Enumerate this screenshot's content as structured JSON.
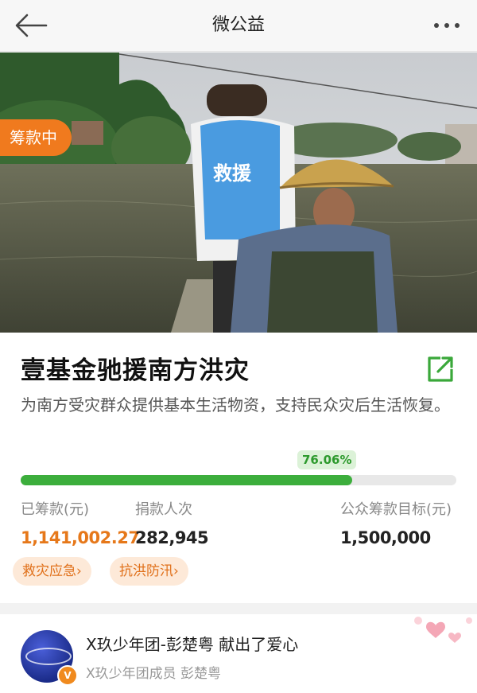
{
  "nav": {
    "title": "微公益",
    "back_icon": "back-arrow-icon",
    "more_icon": "more-dots-icon"
  },
  "hero": {
    "status_badge": "筹款中",
    "carousel_pages": 3,
    "carousel_active": 2
  },
  "project": {
    "title": "壹基金驰援南方洪灾",
    "description": "为南方受灾群众提供基本生活物资，支持民众灾后生活恢复。",
    "share_icon": "share-external-icon",
    "progress": {
      "percent_label": "76.06%",
      "fraction": 0.7606
    },
    "stats": [
      {
        "label": "已筹款(元)",
        "value": "1,141,002.27"
      },
      {
        "label": "捐款人次",
        "value": "282,945"
      },
      {
        "label": "公众筹款目标(元)",
        "value": "1,500,000"
      }
    ],
    "tags": [
      "救灾应急›",
      "抗洪防汛›"
    ]
  },
  "donor": {
    "line": "X玖少年团-彭楚粤 献出了爱心",
    "sub": "X玖少年团成员 彭楚粤",
    "badge": "V"
  },
  "colors": {
    "accent_orange": "#f07a1e",
    "progress_green": "#3cae3c",
    "share_green": "#3aa83a"
  }
}
